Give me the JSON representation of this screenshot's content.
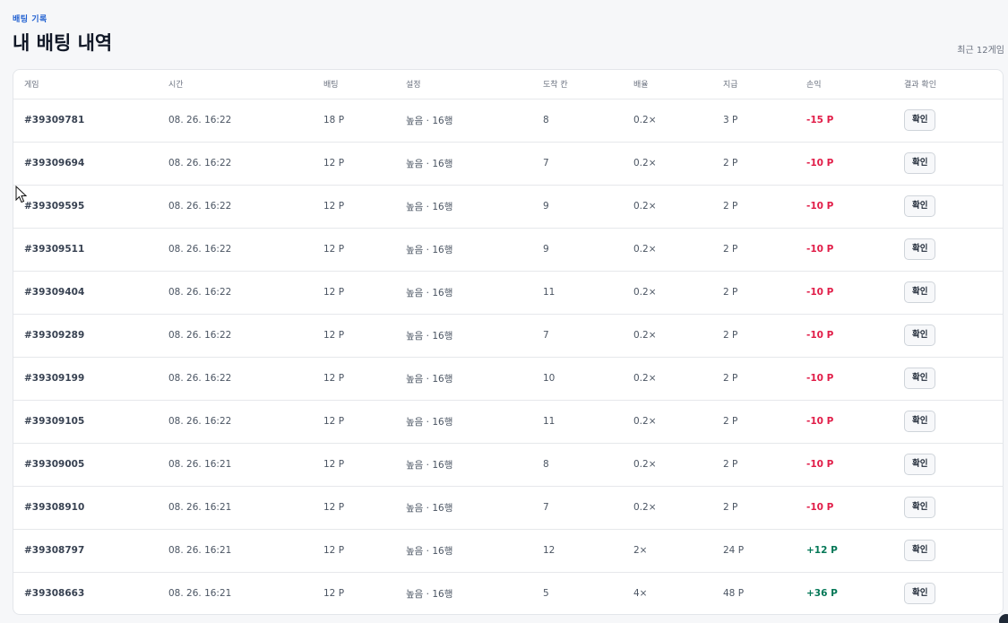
{
  "header": {
    "eyebrow": "배팅 기록",
    "title": "내 배팅 내역",
    "count": "최근 12게임"
  },
  "table": {
    "columns": [
      "게임",
      "시간",
      "배팅",
      "설정",
      "도착 칸",
      "배율",
      "지급",
      "손익",
      "결과 확인"
    ],
    "rows": [
      {
        "game": "#39309781",
        "time": "08. 26. 16:22",
        "bet": "18 P",
        "setting": "높음 · 16행",
        "slot": "8",
        "multiplier": "0.2×",
        "payout": "3 P",
        "profit": "-15 P",
        "profit_sign": "neg",
        "action": "확인"
      },
      {
        "game": "#39309694",
        "time": "08. 26. 16:22",
        "bet": "12 P",
        "setting": "높음 · 16행",
        "slot": "7",
        "multiplier": "0.2×",
        "payout": "2 P",
        "profit": "-10 P",
        "profit_sign": "neg",
        "action": "확인"
      },
      {
        "game": "#39309595",
        "time": "08. 26. 16:22",
        "bet": "12 P",
        "setting": "높음 · 16행",
        "slot": "9",
        "multiplier": "0.2×",
        "payout": "2 P",
        "profit": "-10 P",
        "profit_sign": "neg",
        "action": "확인"
      },
      {
        "game": "#39309511",
        "time": "08. 26. 16:22",
        "bet": "12 P",
        "setting": "높음 · 16행",
        "slot": "9",
        "multiplier": "0.2×",
        "payout": "2 P",
        "profit": "-10 P",
        "profit_sign": "neg",
        "action": "확인"
      },
      {
        "game": "#39309404",
        "time": "08. 26. 16:22",
        "bet": "12 P",
        "setting": "높음 · 16행",
        "slot": "11",
        "multiplier": "0.2×",
        "payout": "2 P",
        "profit": "-10 P",
        "profit_sign": "neg",
        "action": "확인"
      },
      {
        "game": "#39309289",
        "time": "08. 26. 16:22",
        "bet": "12 P",
        "setting": "높음 · 16행",
        "slot": "7",
        "multiplier": "0.2×",
        "payout": "2 P",
        "profit": "-10 P",
        "profit_sign": "neg",
        "action": "확인"
      },
      {
        "game": "#39309199",
        "time": "08. 26. 16:22",
        "bet": "12 P",
        "setting": "높음 · 16행",
        "slot": "10",
        "multiplier": "0.2×",
        "payout": "2 P",
        "profit": "-10 P",
        "profit_sign": "neg",
        "action": "확인"
      },
      {
        "game": "#39309105",
        "time": "08. 26. 16:22",
        "bet": "12 P",
        "setting": "높음 · 16행",
        "slot": "11",
        "multiplier": "0.2×",
        "payout": "2 P",
        "profit": "-10 P",
        "profit_sign": "neg",
        "action": "확인"
      },
      {
        "game": "#39309005",
        "time": "08. 26. 16:21",
        "bet": "12 P",
        "setting": "높음 · 16행",
        "slot": "8",
        "multiplier": "0.2×",
        "payout": "2 P",
        "profit": "-10 P",
        "profit_sign": "neg",
        "action": "확인"
      },
      {
        "game": "#39308910",
        "time": "08. 26. 16:21",
        "bet": "12 P",
        "setting": "높음 · 16행",
        "slot": "7",
        "multiplier": "0.2×",
        "payout": "2 P",
        "profit": "-10 P",
        "profit_sign": "neg",
        "action": "확인"
      },
      {
        "game": "#39308797",
        "time": "08. 26. 16:21",
        "bet": "12 P",
        "setting": "높음 · 16행",
        "slot": "12",
        "multiplier": "2×",
        "payout": "24 P",
        "profit": "+12 P",
        "profit_sign": "pos",
        "action": "확인"
      },
      {
        "game": "#39308663",
        "time": "08. 26. 16:21",
        "bet": "12 P",
        "setting": "높음 · 16행",
        "slot": "5",
        "multiplier": "4×",
        "payout": "48 P",
        "profit": "+36 P",
        "profit_sign": "pos",
        "action": "확인"
      }
    ]
  },
  "colors": {
    "accent": "#1f5fd1",
    "loss": "#e11d48",
    "gain": "#047857"
  },
  "icons": {
    "cursor": "mouse-pointer-icon"
  }
}
